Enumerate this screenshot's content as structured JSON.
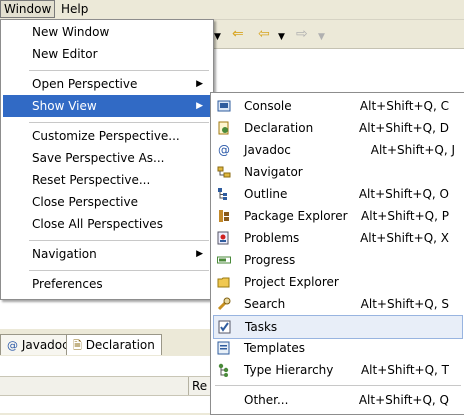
{
  "menubar": {
    "window": "Window",
    "help": "Help"
  },
  "window_menu": {
    "items": [
      {
        "label": "New Window"
      },
      {
        "label": "New Editor"
      },
      {
        "label": "Open Perspective"
      },
      {
        "label": "Show View"
      },
      {
        "label": "Customize Perspective..."
      },
      {
        "label": "Save Perspective As..."
      },
      {
        "label": "Reset Perspective..."
      },
      {
        "label": "Close Perspective"
      },
      {
        "label": "Close All Perspectives"
      },
      {
        "label": "Navigation"
      },
      {
        "label": "Preferences"
      }
    ]
  },
  "show_view_menu": {
    "items": [
      {
        "label": "Console",
        "shortcut": "Alt+Shift+Q, C",
        "icon": "console-icon"
      },
      {
        "label": "Declaration",
        "shortcut": "Alt+Shift+Q, D",
        "icon": "declaration-icon"
      },
      {
        "label": "Javadoc",
        "shortcut": "Alt+Shift+Q, J",
        "icon": "javadoc-icon"
      },
      {
        "label": "Navigator",
        "shortcut": "",
        "icon": "navigator-icon"
      },
      {
        "label": "Outline",
        "shortcut": "Alt+Shift+Q, O",
        "icon": "outline-icon"
      },
      {
        "label": "Package Explorer",
        "shortcut": "Alt+Shift+Q, P",
        "icon": "package-explorer-icon"
      },
      {
        "label": "Problems",
        "shortcut": "Alt+Shift+Q, X",
        "icon": "problems-icon"
      },
      {
        "label": "Progress",
        "shortcut": "",
        "icon": "progress-icon"
      },
      {
        "label": "Project Explorer",
        "shortcut": "",
        "icon": "project-explorer-icon"
      },
      {
        "label": "Search",
        "shortcut": "Alt+Shift+Q, S",
        "icon": "search-icon"
      },
      {
        "label": "Tasks",
        "shortcut": "",
        "icon": "tasks-icon"
      },
      {
        "label": "Templates",
        "shortcut": "",
        "icon": "templates-icon"
      },
      {
        "label": "Type Hierarchy",
        "shortcut": "Alt+Shift+Q, T",
        "icon": "type-hierarchy-icon"
      },
      {
        "label": "Other...",
        "shortcut": "Alt+Shift+Q, Q",
        "icon": ""
      }
    ]
  },
  "views": {
    "tabs": [
      {
        "label": "Javadoc"
      },
      {
        "label": "Declaration"
      }
    ],
    "column_header": "Re"
  },
  "colors": {
    "selection": "#316ac5",
    "hover": "#e8eef8",
    "menu_bg": "#ffffff",
    "chrome": "#ece9d8"
  }
}
